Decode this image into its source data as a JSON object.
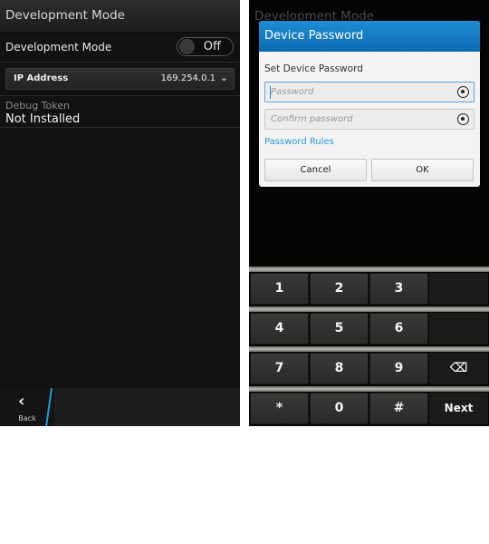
{
  "left": {
    "title": "Development Mode",
    "dev_mode": {
      "label": "Development Mode",
      "toggle_state": "Off"
    },
    "ip": {
      "label": "IP Address",
      "value": "169.254.0.1",
      "chevron": "chevron-down-icon"
    },
    "debug": {
      "label": "Debug Token",
      "value": "Not Installed"
    },
    "back": {
      "label": "Back",
      "icon": "chevron-left-icon"
    }
  },
  "right": {
    "bg_title": "Development Mode",
    "dialog": {
      "title": "Device Password",
      "subtitle": "Set Device Password",
      "password_placeholder": "Password",
      "confirm_placeholder": "Confirm password",
      "rules_link": "Password Rules",
      "cancel": "Cancel",
      "ok": "OK"
    },
    "keyboard": {
      "rows": [
        [
          "1",
          "2",
          "3",
          ""
        ],
        [
          "4",
          "5",
          "6",
          ""
        ],
        [
          "7",
          "8",
          "9",
          "⌫"
        ],
        [
          "*",
          "0",
          "#",
          "Next"
        ]
      ]
    }
  },
  "colors": {
    "accent": "#1a9fe0",
    "dialog_header": "#1277c4",
    "link": "#2c9ad8"
  }
}
